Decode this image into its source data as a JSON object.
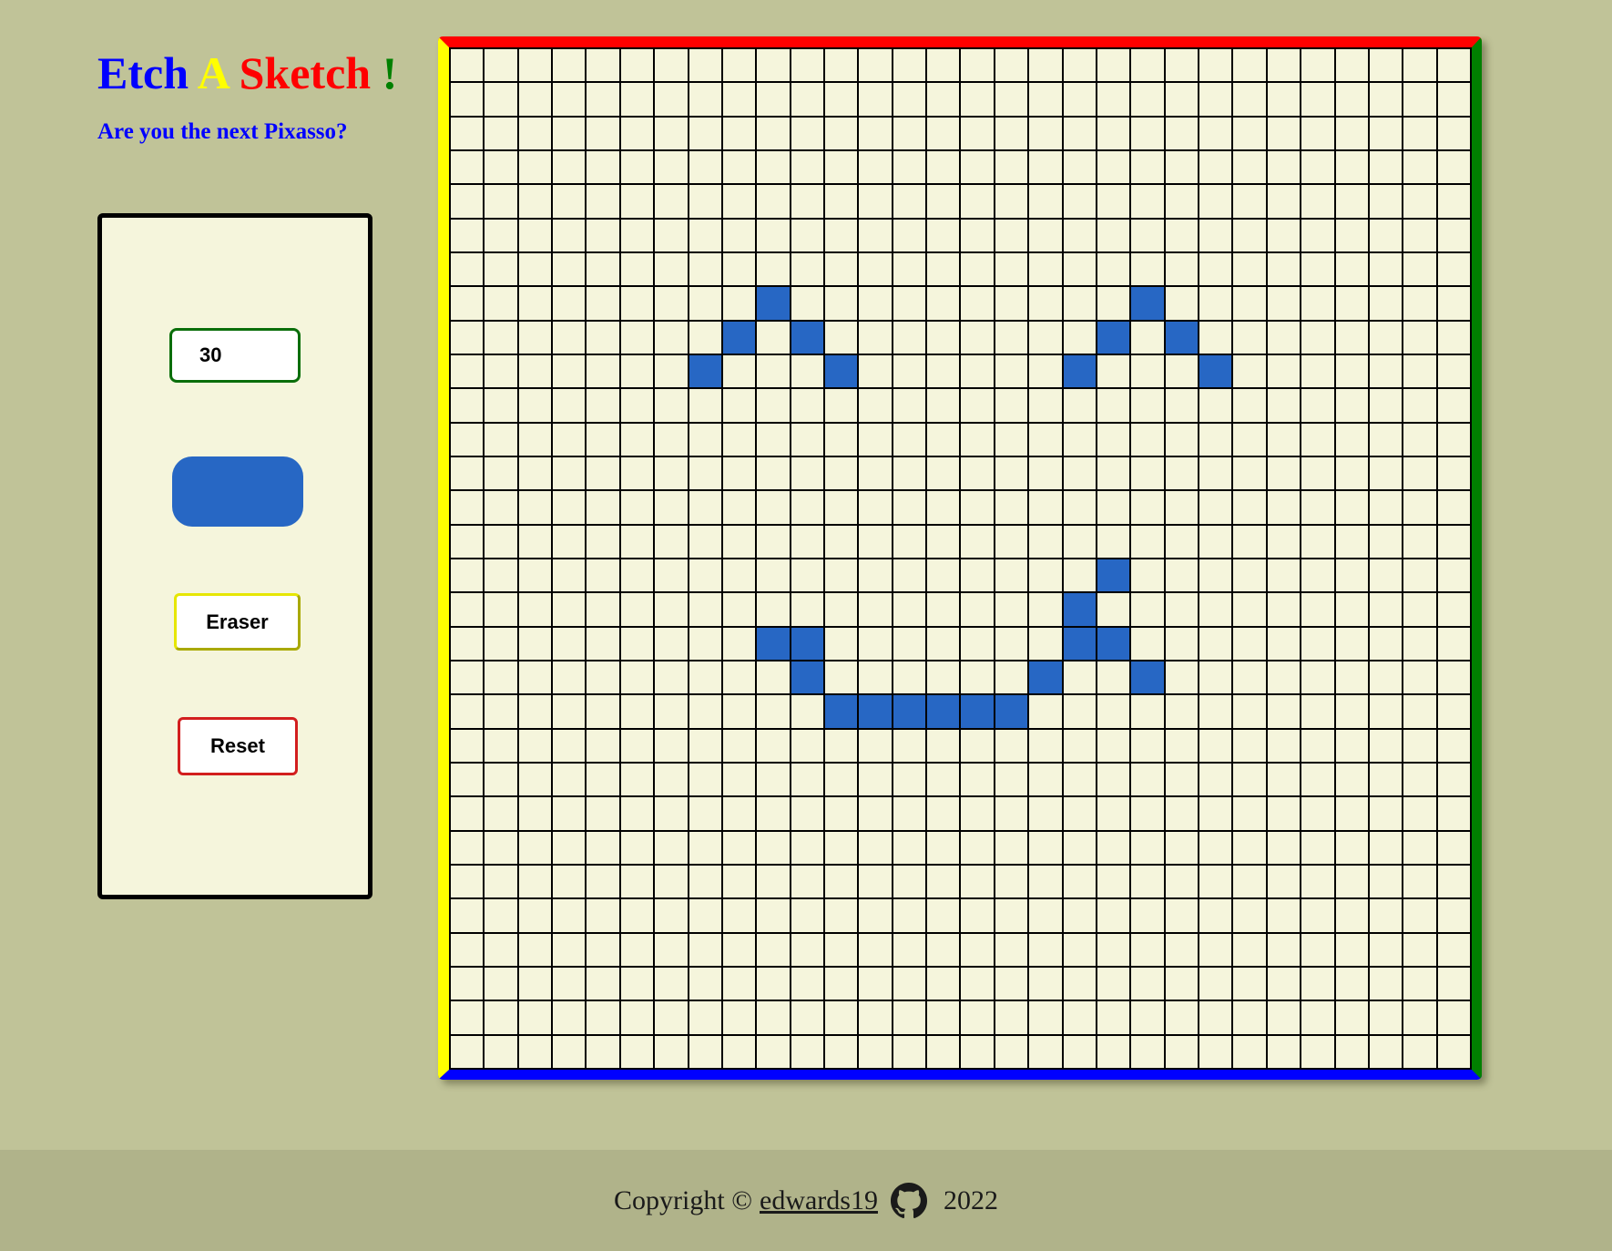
{
  "header": {
    "title_parts": [
      "Etch",
      "A",
      "Sketch",
      "!"
    ],
    "title_colors": [
      "#0000ff",
      "#ffff00",
      "#ff0000",
      "#008000"
    ],
    "subtitle": "Are you the next Pixasso?",
    "subtitle_color": "#0000ff"
  },
  "controls": {
    "grid_size_value": "30",
    "pen_color": "#2767c4",
    "eraser_label": "Eraser",
    "reset_label": "Reset"
  },
  "board": {
    "rows": 30,
    "cols": 30,
    "cell_color": "#f5f5dc",
    "line_color": "#000000",
    "border_colors": {
      "top": "#ff0000",
      "right": "#008000",
      "bottom": "#0000ff",
      "left": "#ffff00"
    },
    "painted_cells": [
      [
        7,
        9
      ],
      [
        7,
        20
      ],
      [
        8,
        8
      ],
      [
        8,
        10
      ],
      [
        8,
        19
      ],
      [
        8,
        21
      ],
      [
        9,
        7
      ],
      [
        9,
        11
      ],
      [
        9,
        18
      ],
      [
        9,
        22
      ],
      [
        15,
        19
      ],
      [
        16,
        18
      ],
      [
        17,
        9
      ],
      [
        17,
        10
      ],
      [
        17,
        18
      ],
      [
        17,
        19
      ],
      [
        18,
        10
      ],
      [
        18,
        17
      ],
      [
        18,
        20
      ],
      [
        19,
        11
      ],
      [
        19,
        12
      ],
      [
        19,
        13
      ],
      [
        19,
        14
      ],
      [
        19,
        15
      ],
      [
        19,
        16
      ]
    ]
  },
  "footer": {
    "copyright_text": "Copyright ©",
    "author_link": "edwards19",
    "year": "2022",
    "icon": "github-icon"
  }
}
